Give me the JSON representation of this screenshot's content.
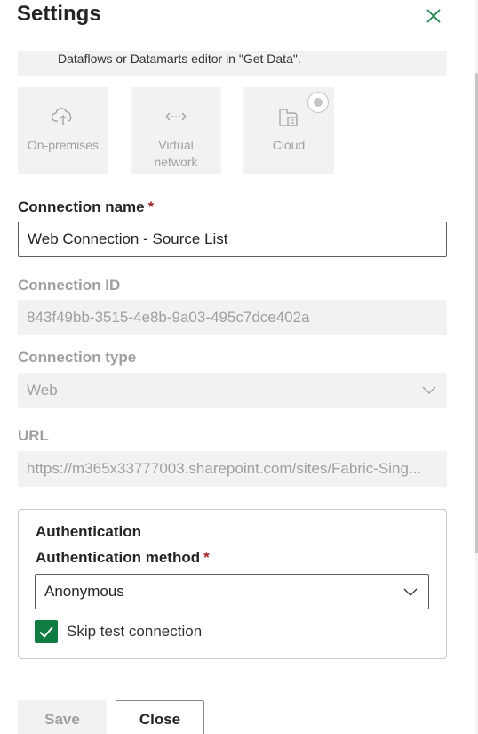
{
  "header": {
    "title": "Settings"
  },
  "info": {
    "text": "Dataflows or Datamarts editor in \"Get Data\"."
  },
  "gateway_options": [
    {
      "label": "On-premises",
      "icon": "cloud-upload-icon"
    },
    {
      "label": "Virtual network",
      "icon": "virtual-network-icon"
    },
    {
      "label": "Cloud",
      "icon": "cloud-building-icon",
      "selected": true
    }
  ],
  "connection_name": {
    "label": "Connection name",
    "required": "*",
    "value": "Web Connection - Source List"
  },
  "connection_id": {
    "label": "Connection ID",
    "value": "843f49bb-3515-4e8b-9a03-495c7dce402a"
  },
  "connection_type": {
    "label": "Connection type",
    "value": "Web"
  },
  "url": {
    "label": "URL",
    "value": "https://m365x33777003.sharepoint.com/sites/Fabric-Sing..."
  },
  "authentication": {
    "title": "Authentication",
    "method_label": "Authentication method",
    "required": "*",
    "method_value": "Anonymous",
    "skip_test_label": "Skip test connection",
    "skip_test_checked": true
  },
  "footer": {
    "save_label": "Save",
    "close_label": "Close"
  },
  "colors": {
    "accent": "#107c41",
    "disabled_text": "#a19f9d",
    "disabled_bg": "#f3f2f1",
    "required": "#a4262c"
  }
}
